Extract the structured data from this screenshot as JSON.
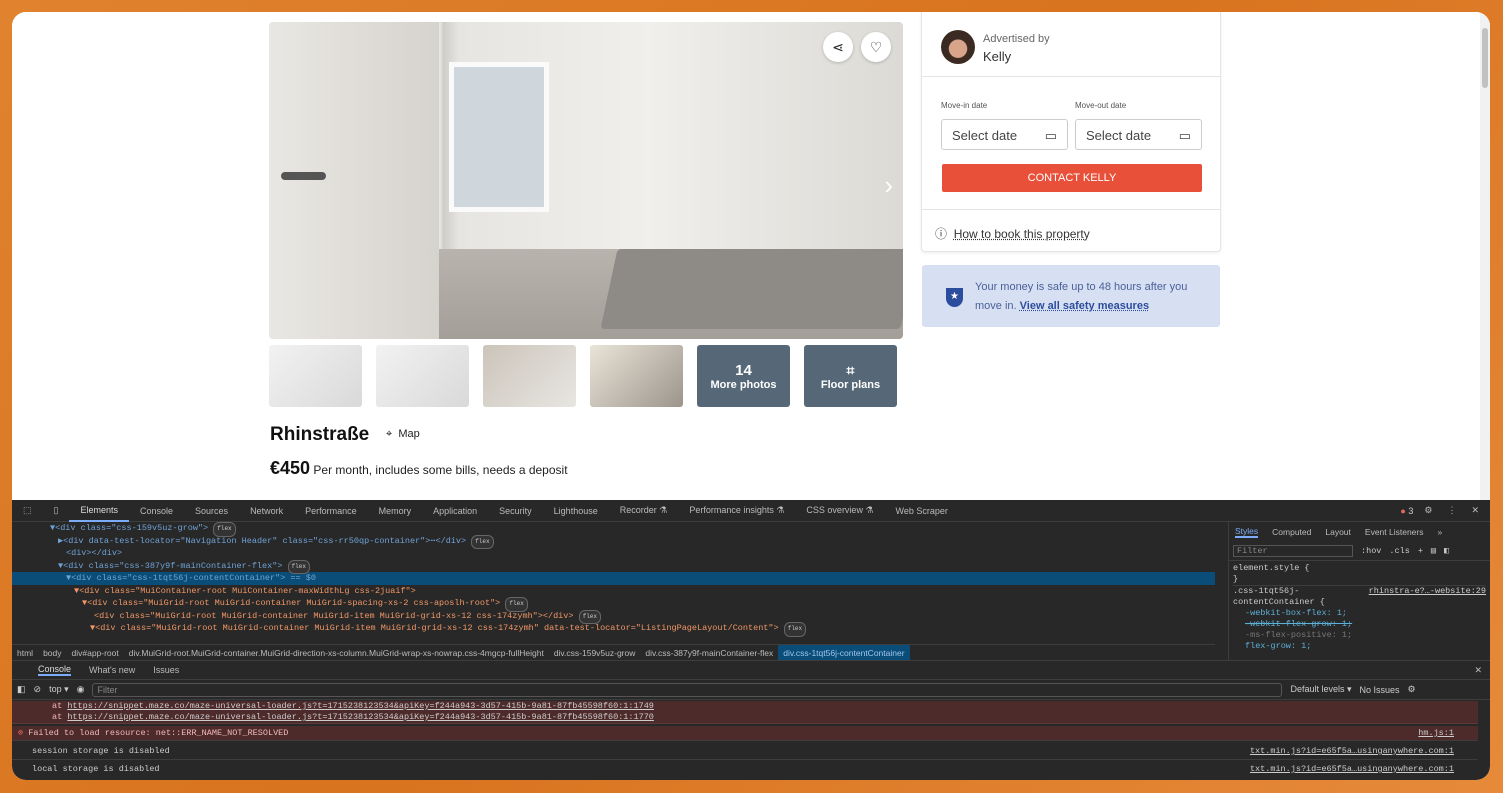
{
  "listing": {
    "title": "Rhinstraße",
    "map_label": "Map",
    "price": "€450",
    "price_note": "Per month, includes some bills, needs a deposit",
    "more_photos_count": "14",
    "more_photos_label": "More photos",
    "floor_plans_label": "Floor plans"
  },
  "sidebar": {
    "advertised_by": "Advertised by",
    "advertiser": "Kelly",
    "move_in_label": "Move-in date",
    "move_out_label": "Move-out date",
    "date_placeholder": "Select date",
    "contact_button": "CONTACT KELLY",
    "how_to_book": "How to book this property",
    "safety_text": "Your money is safe up to 48 hours after you move in.",
    "safety_link": "View all safety measures",
    "accent": "#e8503a"
  },
  "devtools": {
    "tabs": [
      "Elements",
      "Console",
      "Sources",
      "Network",
      "Performance",
      "Memory",
      "Application",
      "Security",
      "Lighthouse",
      "Recorder ⚗",
      "Performance insights ⚗",
      "CSS overview ⚗",
      "Web Scraper"
    ],
    "error_count": "3",
    "dom_lines": [
      "▼<div class=\"css-159v5uz-grow\">",
      "▶<div data-test-locator=\"Navigation Header\" class=\"css-rr50qp-container\">⋯</div>",
      "<div></div>",
      "▼<div class=\"css-387y9f-mainContainer-flex\">",
      "▼<div class=\"css-1tqt56j-contentContainer\"> == $0",
      "▼<div class=\"MuiContainer-root MuiContainer-maxWidthLg css-2juaif\">",
      "▼<div class=\"MuiGrid-root MuiGrid-container MuiGrid-spacing-xs-2 css-aposlh-root\">",
      "<div class=\"MuiGrid-root MuiGrid-container MuiGrid-item MuiGrid-grid-xs-12 css-174zymh\"></div>",
      "▼<div class=\"MuiGrid-root MuiGrid-container MuiGrid-item MuiGrid-grid-xs-12 css-174zymh\" data-test-locator=\"ListingPageLayout/Content\">"
    ],
    "flex_badge": "flex",
    "breadcrumbs": [
      "html",
      "body",
      "div#app-root",
      "div.MuiGrid-root.MuiGrid-container.MuiGrid-direction-xs-column.MuiGrid-wrap-xs-nowrap.css-4mgcp-fullHeight",
      "div.css-159v5uz-grow",
      "div.css-387y9f-mainContainer-flex",
      "div.css-1tqt56j-contentContainer"
    ],
    "styles_tabs": [
      "Styles",
      "Computed",
      "Layout",
      "Event Listeners",
      "»"
    ],
    "styles_filter": "Filter",
    "styles_tools": [
      ":hov",
      ".cls"
    ],
    "styles_rules": [
      "element.style {",
      "}",
      ".css-1tqt56j-",
      "contentContainer {",
      "-webkit-box-flex: 1;",
      "-webkit-flex-grow: 1;",
      "-ms-flex-positive: 1;",
      "flex-grow: 1;"
    ],
    "styles_source": "rhinstra-e?…-website:29",
    "console_tabs": [
      "Console",
      "What's new",
      "Issues"
    ],
    "context": "top ▾",
    "filter_placeholder": "Filter",
    "levels": "Default levels ▾",
    "issues": "No Issues",
    "messages": [
      {
        "text": "at ",
        "link": "https://snippet.maze.co/maze-universal-loader.js?t=1715238123534&apiKey=f244a943-3d57-415b-9a81-87fb45598f60:1:1749"
      },
      {
        "text": "at ",
        "link": "https://snippet.maze.co/maze-universal-loader.js?t=1715238123534&apiKey=f244a943-3d57-415b-9a81-87fb45598f60:1:1770"
      },
      {
        "text": "Failed to load resource: net::ERR_NAME_NOT_RESOLVED",
        "source": "hm.js:1"
      },
      {
        "text": "session storage is disabled",
        "source": "txt.min.js?id=e65f5a…usinganywhere.com:1"
      },
      {
        "text": "local storage is disabled",
        "source": "txt.min.js?id=e65f5a…usinganywhere.com:1"
      }
    ]
  }
}
